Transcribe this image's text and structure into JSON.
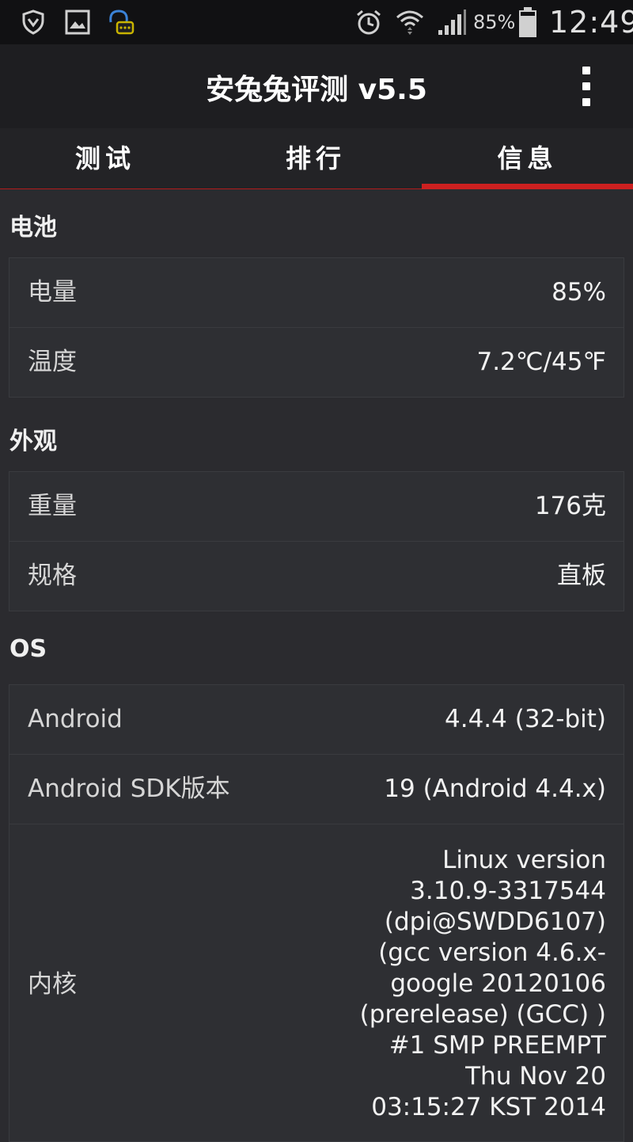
{
  "status_bar": {
    "battery_percent": "85%",
    "time": "12:49",
    "icons": [
      "shield-icon",
      "gallery-icon",
      "qq-chat-icon",
      "alarm-icon",
      "wifi-icon",
      "signal-icon",
      "battery-icon"
    ]
  },
  "action_bar": {
    "title": "安兔兔评测 v5.5",
    "menu_icon": "overflow-menu-icon"
  },
  "tabs": [
    {
      "label": "测试"
    },
    {
      "label": "排行"
    },
    {
      "label": "信息",
      "selected": true
    }
  ],
  "sections": {
    "battery": {
      "title": "电池",
      "rows": [
        {
          "label": "电量",
          "value": "85%"
        },
        {
          "label": "温度",
          "value": "7.2℃/45℉"
        }
      ]
    },
    "appearance": {
      "title": "外观",
      "rows": [
        {
          "label": "重量",
          "value": "176克"
        },
        {
          "label": "规格",
          "value": "直板"
        }
      ]
    },
    "os": {
      "title": "OS",
      "rows": [
        {
          "label": "Android",
          "value": "4.4.4 (32-bit)"
        },
        {
          "label": "Android SDK版本",
          "value": "19  (Android 4.4.x)"
        },
        {
          "label": "内核",
          "value": "Linux version 3.10.9-3317544 (dpi@SWDD6107) (gcc version 4.6.x-google 20120106 (prerelease) (GCC) ) #1 SMP PREEMPT Thu Nov 20 03:15:27 KST 2014"
        }
      ]
    }
  },
  "colors": {
    "accent": "#cc2020",
    "background": "#2b2b2f",
    "card": "#2e2f33"
  }
}
